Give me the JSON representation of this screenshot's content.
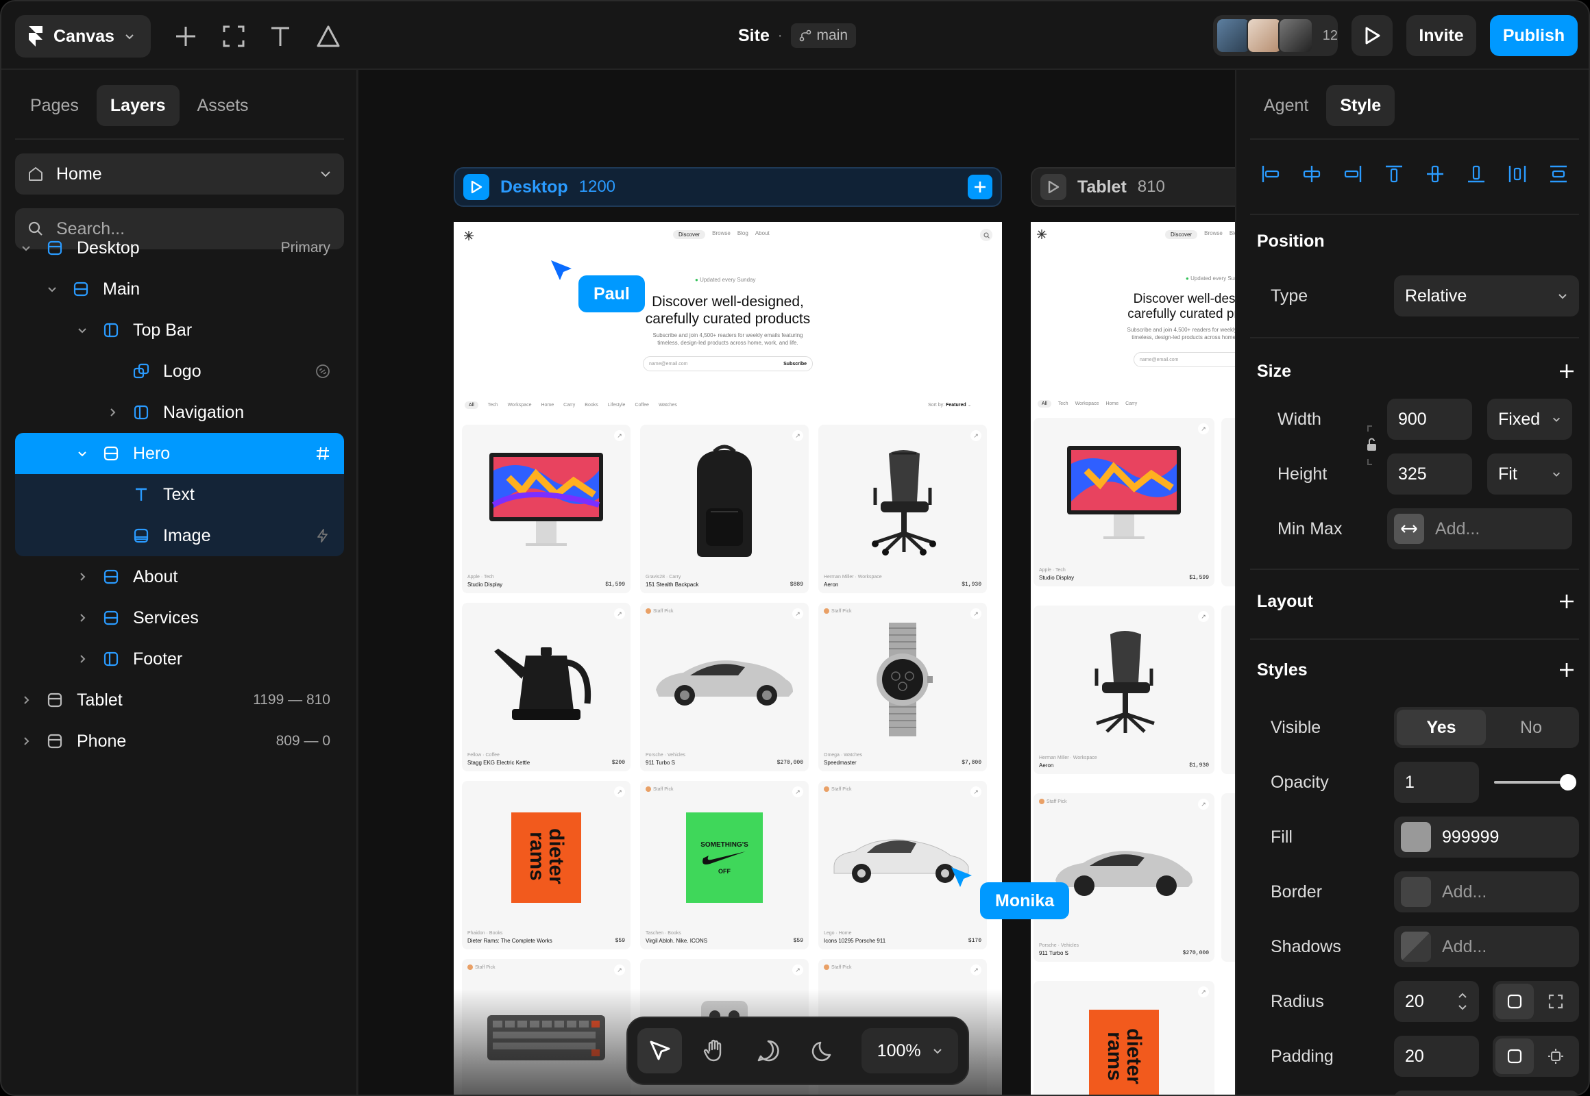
{
  "topbar": {
    "workspace": "Canvas",
    "site_title": "Site",
    "separator": "·",
    "branch": "main",
    "collab_count": "12",
    "invite_label": "Invite",
    "publish_label": "Publish"
  },
  "left_panel": {
    "tabs": [
      "Pages",
      "Layers",
      "Assets"
    ],
    "active_tab": "Layers",
    "page_select": "Home",
    "search_placeholder": "Search...",
    "layers": [
      {
        "name": "Desktop",
        "meta": "Primary",
        "icon": "stack-icon"
      },
      {
        "name": "Main",
        "meta": "",
        "icon": "stack-icon"
      },
      {
        "name": "Top Bar",
        "meta": "",
        "icon": "columns-icon"
      },
      {
        "name": "Logo",
        "meta": "",
        "icon": "component-icon"
      },
      {
        "name": "Navigation",
        "meta": "",
        "icon": "columns-icon"
      },
      {
        "name": "Hero",
        "meta": "",
        "icon": "stack-icon"
      },
      {
        "name": "Text",
        "meta": "",
        "icon": "text-icon"
      },
      {
        "name": "Image",
        "meta": "",
        "icon": "image-icon"
      },
      {
        "name": "About",
        "meta": "",
        "icon": "stack-icon"
      },
      {
        "name": "Services",
        "meta": "",
        "icon": "stack-icon"
      },
      {
        "name": "Footer",
        "meta": "",
        "icon": "columns-icon"
      },
      {
        "name": "Tablet",
        "meta": "1199 — 810",
        "icon": "stack-icon"
      },
      {
        "name": "Phone",
        "meta": "809 — 0",
        "icon": "stack-icon"
      }
    ]
  },
  "canvas": {
    "desktop": {
      "name": "Desktop",
      "width": "1200"
    },
    "tablet": {
      "name": "Tablet",
      "width": "810"
    },
    "cursors": [
      "Paul",
      "Monika"
    ],
    "zoom": "100%",
    "site": {
      "nav": [
        "Discover",
        "Browse",
        "Blog",
        "About"
      ],
      "updated": "Updated every Sunday",
      "headline_1": "Discover well-designed,",
      "headline_2": "carefully curated products",
      "sub_1": "Subscribe and join 4,500+ readers for weekly emails featuring",
      "sub_2": "timeless, design-led products across home, work, and life.",
      "email_placeholder": "name@email.com",
      "subscribe": "Subscribe",
      "filters": [
        "All",
        "Tech",
        "Workspace",
        "Home",
        "Carry",
        "Books",
        "Lifestyle",
        "Coffee",
        "Watches"
      ],
      "sort_label": "Sort by:",
      "sort_value": "Featured",
      "staff_pick": "Staff Pick",
      "products": [
        {
          "brand": "Apple · Tech",
          "name": "Studio Display",
          "price": "$1,599"
        },
        {
          "brand": "Gravis28 · Carry",
          "name": "151 Stealth Backpack",
          "price": "$889"
        },
        {
          "brand": "Herman Miller · Workspace",
          "name": "Aeron",
          "price": "$1,930"
        },
        {
          "brand": "Fellow · Coffee",
          "name": "Stagg EKG Electric Kettle",
          "price": "$200"
        },
        {
          "brand": "Porsche · Vehicles",
          "name": "911 Turbo S",
          "price": "$270,000"
        },
        {
          "brand": "Omega · Watches",
          "name": "Speedmaster",
          "price": "$7,800"
        },
        {
          "brand": "Phaidon · Books",
          "name": "Dieter Rams: The Complete Works",
          "price": "$59"
        },
        {
          "brand": "Taschen · Books",
          "name": "Virgil Abloh. Nike. ICONS",
          "price": "$59"
        },
        {
          "brand": "Lego · Home",
          "name": "Icons 10295 Porsche 911",
          "price": "$170"
        }
      ],
      "book_title": "dieter rams",
      "book2_title": "SOMETHING'S",
      "book2_sub": "OFF"
    }
  },
  "right_panel": {
    "tabs": [
      "Agent",
      "Style"
    ],
    "active_tab": "Style",
    "position": {
      "title": "Position",
      "type_label": "Type",
      "type_value": "Relative"
    },
    "size": {
      "title": "Size",
      "width_label": "Width",
      "width_value": "900",
      "width_mode": "Fixed",
      "height_label": "Height",
      "height_value": "325",
      "height_mode": "Fit",
      "minmax_label": "Min Max",
      "minmax_placeholder": "Add..."
    },
    "layout": {
      "title": "Layout"
    },
    "styles": {
      "title": "Styles",
      "visible_label": "Visible",
      "visible_yes": "Yes",
      "visible_no": "No",
      "opacity_label": "Opacity",
      "opacity_value": "1",
      "opacity_level": 1,
      "fill_label": "Fill",
      "fill_value": "999999",
      "fill_color": "#999999",
      "border_label": "Border",
      "border_placeholder": "Add...",
      "shadows_label": "Shadows",
      "shadows_placeholder": "Add...",
      "radius_label": "Radius",
      "radius_value": "20",
      "padding_label": "Padding",
      "padding_value": "20"
    }
  },
  "colors": {
    "accent": "#0099ff",
    "bg": "#171717",
    "surface": "#2a2a2a"
  }
}
